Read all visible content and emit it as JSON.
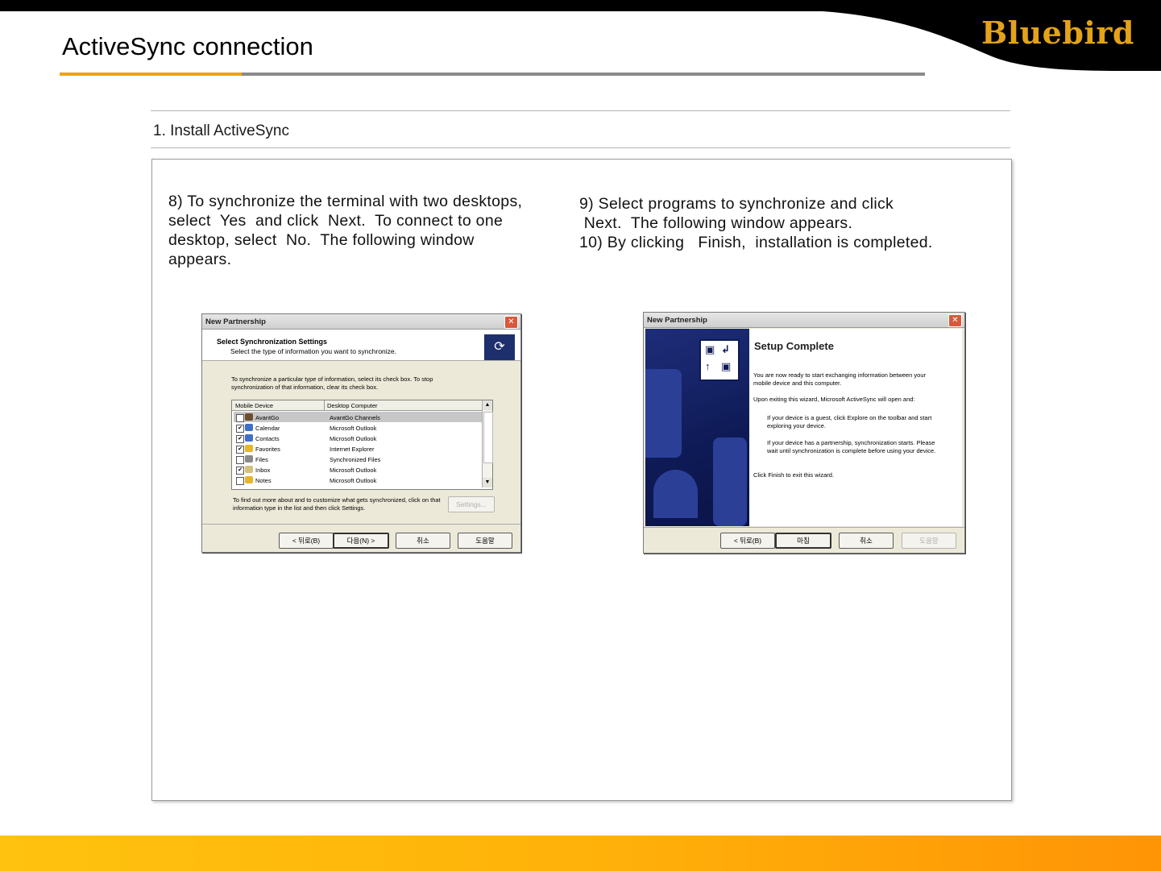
{
  "header": {
    "title": "ActiveSync connection",
    "logo": "Bluebird",
    "colors": {
      "accent": "#f2a20f",
      "rule": "#8a8a8a",
      "logo": "#e3a21a"
    }
  },
  "section": {
    "label": "1. Install ActiveSync"
  },
  "notes": {
    "left": [
      "8) To synchronize the terminal with two desktops,",
      "select  Yes  and click  Next.  To connect to one",
      "desktop, select  No.  The following window",
      "appears."
    ],
    "right": [
      "9) Select programs to synchronize and click",
      " Next.  The following window appears.",
      "10) By clicking   Finish,  installation is completed."
    ]
  },
  "dialog1": {
    "title": "New Partnership",
    "heading": "Select Synchronization Settings",
    "subheading": "Select the type of information you want to synchronize.",
    "intro": "To synchronize a particular type of information, select its check box. To stop synchronization of that information, clear its check box.",
    "columns": [
      "Mobile Device",
      "Desktop Computer"
    ],
    "rows": [
      {
        "device": "AvantGo",
        "desktop": "AvantGo Channels",
        "checked": false,
        "icon_color": "#6b4f2a"
      },
      {
        "device": "Calendar",
        "desktop": "Microsoft Outlook",
        "checked": true,
        "icon_color": "#3f6fc6"
      },
      {
        "device": "Contacts",
        "desktop": "Microsoft Outlook",
        "checked": true,
        "icon_color": "#3f6fc6"
      },
      {
        "device": "Favorites",
        "desktop": "Internet Explorer",
        "checked": true,
        "icon_color": "#e8b52a"
      },
      {
        "device": "Files",
        "desktop": "Synchronized Files",
        "checked": false,
        "icon_color": "#8a8a8a"
      },
      {
        "device": "Inbox",
        "desktop": "Microsoft Outlook",
        "checked": true,
        "icon_color": "#d4c07a"
      },
      {
        "device": "Notes",
        "desktop": "Microsoft Outlook",
        "checked": false,
        "icon_color": "#e8b52a"
      }
    ],
    "footer_text": "To find out more about and to customize what gets synchronized, click on that information type in the list and then click Settings.",
    "settings_label": "Settings...",
    "buttons": {
      "back": "< 뒤로(B)",
      "next": "다음(N) >",
      "cancel": "취소",
      "help": "도움말"
    }
  },
  "dialog2": {
    "title": "New Partnership",
    "heading": "Setup Complete",
    "para1": "You are now ready to start exchanging information between your mobile device and this computer.",
    "para2": "Upon exiting this wizard, Microsoft ActiveSync will open and:",
    "para3": "If your device is a guest, click Explore on the toolbar and start exploring your device.",
    "para4": "If your device has a partnership, synchronization starts. Please wait until synchronization is complete before using your device.",
    "para5": "Click Finish to exit this wizard.",
    "buttons": {
      "back": "< 뒤로(B)",
      "finish": "마침",
      "cancel": "취소",
      "help": "도움말"
    }
  }
}
